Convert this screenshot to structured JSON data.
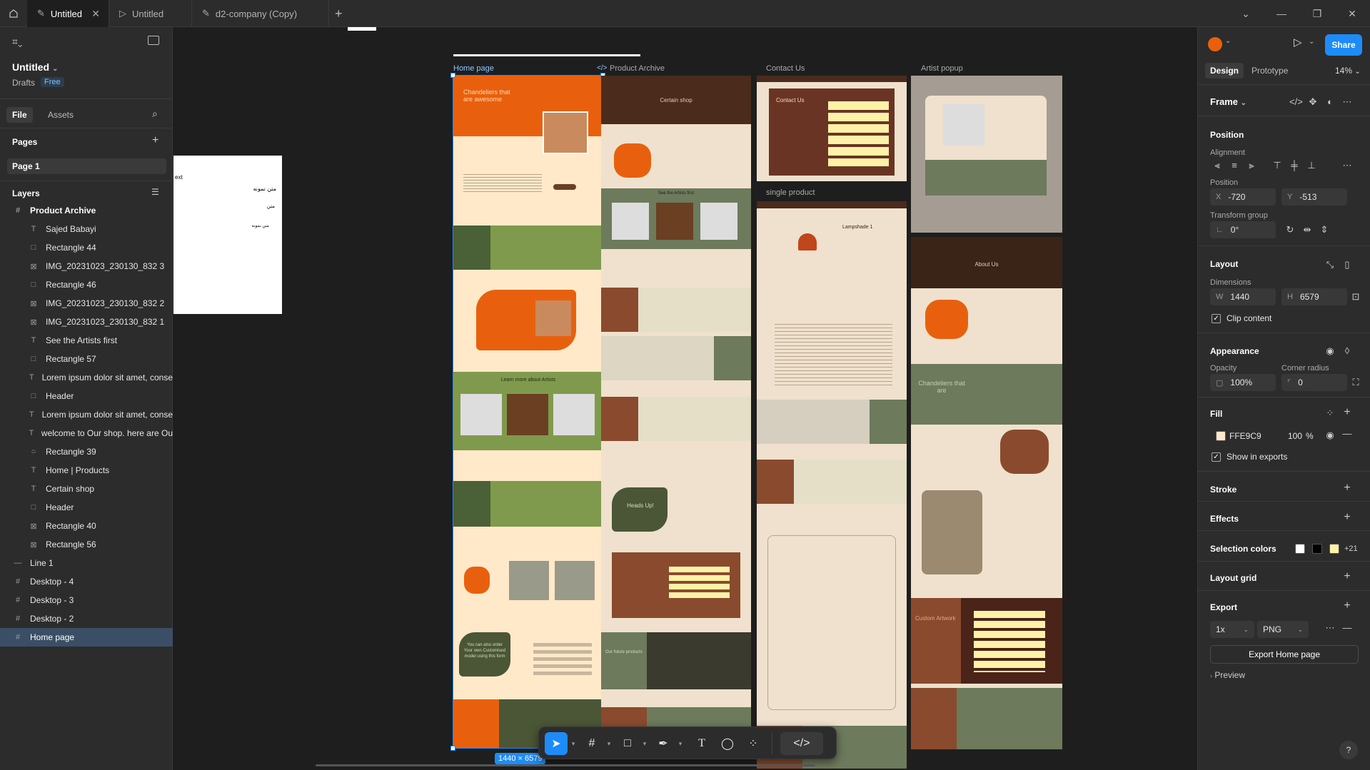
{
  "tabs": [
    {
      "label": "Untitled",
      "active": true
    },
    {
      "label": "Untitled",
      "active": false
    },
    {
      "label": "d2-company (Copy)",
      "active": false
    }
  ],
  "file": {
    "title": "Untitled",
    "location": "Drafts",
    "plan": "Free"
  },
  "left_tabs": {
    "file": "File",
    "assets": "Assets"
  },
  "pages": {
    "header": "Pages",
    "items": [
      "Page 1"
    ]
  },
  "layers": {
    "header": "Layers",
    "items": [
      {
        "label": "Product Archive",
        "icon": "frame-icon",
        "indent": 0,
        "bold": true
      },
      {
        "label": "Sajed Babayi",
        "icon": "text-icon",
        "indent": 1
      },
      {
        "label": "Rectangle 44",
        "icon": "rectangle-icon",
        "indent": 1
      },
      {
        "label": "IMG_20231023_230130_832 3",
        "icon": "image-icon",
        "indent": 1
      },
      {
        "label": "Rectangle 46",
        "icon": "rectangle-icon",
        "indent": 1
      },
      {
        "label": "IMG_20231023_230130_832 2",
        "icon": "image-icon",
        "indent": 1
      },
      {
        "label": "IMG_20231023_230130_832 1",
        "icon": "image-icon",
        "indent": 1
      },
      {
        "label": "See the Artists first",
        "icon": "text-icon",
        "indent": 1
      },
      {
        "label": "Rectangle 57",
        "icon": "rectangle-icon",
        "indent": 1
      },
      {
        "label": "Lorem ipsum dolor sit amet, conse",
        "icon": "text-icon",
        "indent": 1
      },
      {
        "label": "Header",
        "icon": "rectangle-icon",
        "indent": 1
      },
      {
        "label": "Lorem ipsum dolor sit amet, conse",
        "icon": "text-icon",
        "indent": 1
      },
      {
        "label": "welcome to Our shop. here are Ou",
        "icon": "text-icon",
        "indent": 1
      },
      {
        "label": "Rectangle 39",
        "icon": "ellipse-icon",
        "indent": 1
      },
      {
        "label": "Home | Products",
        "icon": "text-icon",
        "indent": 1
      },
      {
        "label": "Certain shop",
        "icon": "text-icon",
        "indent": 1
      },
      {
        "label": "Header",
        "icon": "rectangle-icon",
        "indent": 1
      },
      {
        "label": "Rectangle 40",
        "icon": "image-icon",
        "indent": 1
      },
      {
        "label": "Rectangle 56",
        "icon": "image-icon",
        "indent": 1
      },
      {
        "label": "Line 1",
        "icon": "line-icon",
        "indent": 0
      },
      {
        "label": "Desktop - 4",
        "icon": "frame-icon",
        "indent": 0
      },
      {
        "label": "Desktop - 3",
        "icon": "frame-icon",
        "indent": 0
      },
      {
        "label": "Desktop - 2",
        "icon": "frame-icon",
        "indent": 0
      },
      {
        "label": "Home page",
        "icon": "frame-icon",
        "indent": 0,
        "selected": true
      }
    ]
  },
  "canvas": {
    "frames": [
      "Home page",
      "Product Archive",
      "Contact Us",
      "single product",
      "Artist popup",
      "About Us"
    ],
    "partial_texts": {
      "ext": "ext",
      "arabic_1": "متن نمونه",
      "arabic_2": "متن",
      "arabic_3": "متن نمونه"
    },
    "home": {
      "hero": "Chandeliers that are awesome",
      "artists": "Learn more about Artists",
      "custom": "You can also order Your own Customised model using this form"
    },
    "archive": {
      "title": "Certain shop",
      "artists": "See the Artists first",
      "heads_up": "Heads Up!",
      "future": "Our future products"
    },
    "contact": {
      "title": "Contact Us"
    },
    "single": {
      "title": "Lampshade 1"
    },
    "about": {
      "title": "About Us",
      "chandeliers": "Chandeliers that are",
      "custom": "Custom Artwork"
    },
    "selection_size": "1440 × 6579"
  },
  "right": {
    "tabs": {
      "design": "Design",
      "prototype": "Prototype"
    },
    "zoom": "14%",
    "share": "Share",
    "frame_label": "Frame",
    "position": {
      "header": "Position",
      "alignment": "Alignment",
      "position_label": "Position",
      "x": "-720",
      "y": "-513",
      "transform": "Transform group",
      "rotation": "0°"
    },
    "layout": {
      "header": "Layout",
      "dimensions": "Dimensions",
      "w": "1440",
      "h": "6579",
      "clip": "Clip content"
    },
    "appearance": {
      "header": "Appearance",
      "opacity_label": "Opacity",
      "opacity": "100%",
      "radius_label": "Corner radius",
      "radius": "0"
    },
    "fill": {
      "header": "Fill",
      "hex": "FFE9C9",
      "opacity": "100",
      "pct": "%",
      "show": "Show in exports",
      "color": "#FFE9C9"
    },
    "stroke": "Stroke",
    "effects": "Effects",
    "selection_colors": {
      "header": "Selection colors",
      "more": "+21",
      "colors": [
        "#FFFFFF",
        "#000000",
        "#FFF2A8"
      ]
    },
    "layout_grid": "Layout grid",
    "export": {
      "header": "Export",
      "scale": "1x",
      "format": "PNG",
      "button": "Export Home page"
    },
    "preview": "Preview"
  }
}
